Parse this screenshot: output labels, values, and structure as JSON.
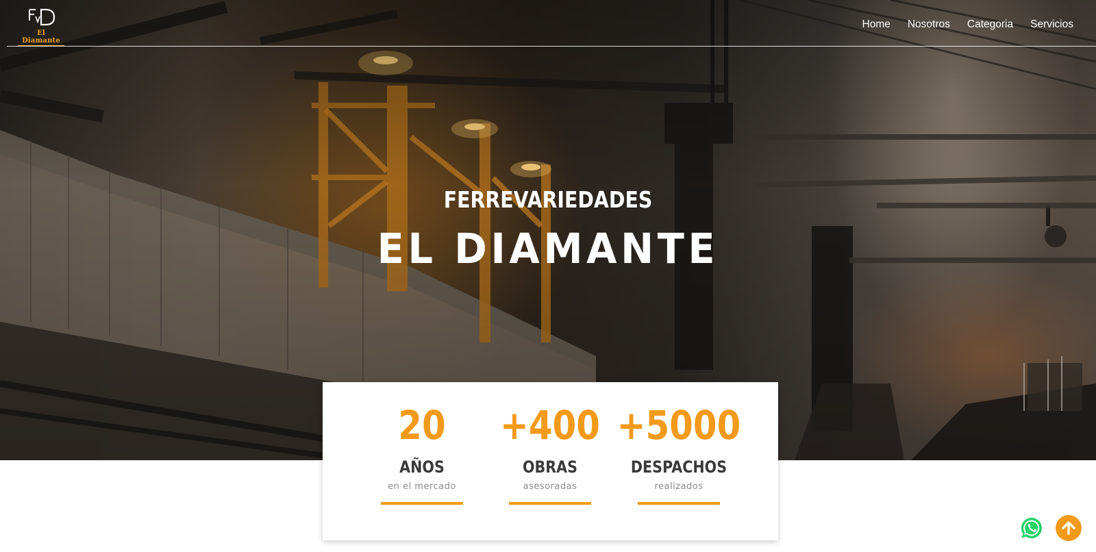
{
  "brand": {
    "logo_mark": "FvD",
    "logo_text": "El Diamante"
  },
  "nav": {
    "items": [
      {
        "label": "Home"
      },
      {
        "label": "Nosotros"
      },
      {
        "label": "Categoria"
      },
      {
        "label": "Servicios"
      }
    ]
  },
  "hero": {
    "subtitle": "FERREVARIEDADES",
    "title": "EL DIAMANTE",
    "background": "industrial-steel-plant-photo"
  },
  "stats": [
    {
      "value": "20",
      "label": "AÑOS",
      "description": "en el mercado"
    },
    {
      "value": "+400",
      "label": "OBRAS",
      "description": "asesoradas"
    },
    {
      "value": "+5000",
      "label": "DESPACHOS",
      "description": "realizados"
    }
  ],
  "floating": {
    "whatsapp_icon": "whatsapp-icon",
    "scroll_top_icon": "arrow-up-icon"
  },
  "colors": {
    "accent": "#f39a1b",
    "logo_gold": "#f2a321",
    "whatsapp_green": "#25d366",
    "heading_dark": "#3a3a3a",
    "muted_text": "#8a8a8a"
  }
}
